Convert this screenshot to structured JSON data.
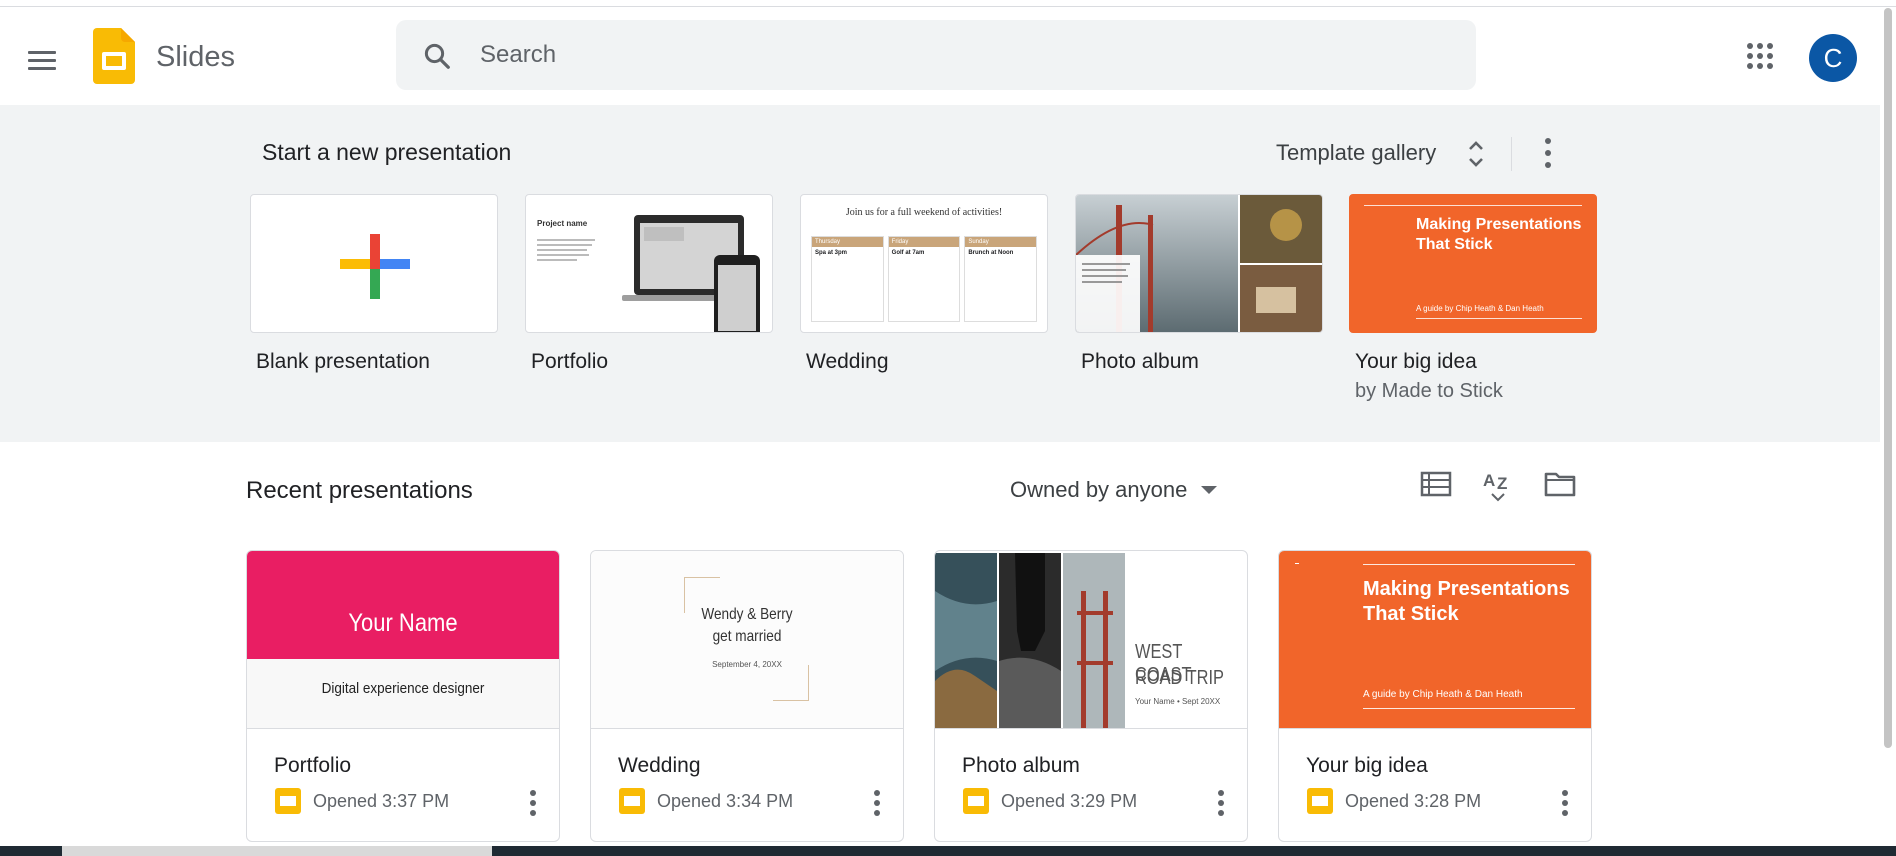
{
  "header": {
    "app_name": "Slides",
    "search_placeholder": "Search",
    "avatar_initial": "C",
    "brand_color": "#f9bb05"
  },
  "templates": {
    "section_title": "Start a new presentation",
    "gallery_label": "Template gallery",
    "items": [
      {
        "name": "Blank presentation",
        "sub": ""
      },
      {
        "name": "Portfolio",
        "sub": "",
        "thumb_title": "Project name"
      },
      {
        "name": "Wedding",
        "sub": "",
        "thumb_title": "Join us for a full weekend of activities!",
        "days": [
          "Thursday",
          "Friday",
          "Sunday"
        ],
        "events": [
          "Spa at 3pm",
          "Golf at 7am",
          "Brunch at Noon"
        ]
      },
      {
        "name": "Photo album",
        "sub": ""
      },
      {
        "name": "Your big idea",
        "sub": "by Made to Stick",
        "thumb_title": "Making Presentations That Stick",
        "thumb_sub": "A guide by Chip Heath & Dan Heath"
      }
    ]
  },
  "recent": {
    "section_title": "Recent presentations",
    "owner_filter": "Owned by anyone",
    "items": [
      {
        "name": "Portfolio",
        "time": "Opened 3:37 PM",
        "thumb_title": "Your Name",
        "thumb_sub": "Digital experience designer"
      },
      {
        "name": "Wedding",
        "time": "Opened 3:34 PM",
        "thumb_title_1": "Wendy & Berry",
        "thumb_title_2": "get married",
        "thumb_sub": "September 4, 20XX"
      },
      {
        "name": "Photo album",
        "time": "Opened 3:29 PM",
        "thumb_title_1": "WEST COAST",
        "thumb_title_2": "ROAD TRIP",
        "thumb_sub": "Your Name • Sept 20XX"
      },
      {
        "name": "Your big idea",
        "time": "Opened 3:28 PM",
        "thumb_title": "Making Presentations That Stick",
        "thumb_sub": "A guide by Chip Heath & Dan Heath"
      }
    ]
  },
  "colors": {
    "portfolio_pink": "#e91e63",
    "orange": "#f1652a",
    "avatar_blue": "#0b57a5"
  },
  "icons": [
    "menu-icon",
    "slides-logo-icon",
    "search-icon",
    "apps-grid-icon",
    "unfold-icon",
    "more-vert-icon",
    "list-view-icon",
    "sort-az-icon",
    "folder-icon"
  ]
}
